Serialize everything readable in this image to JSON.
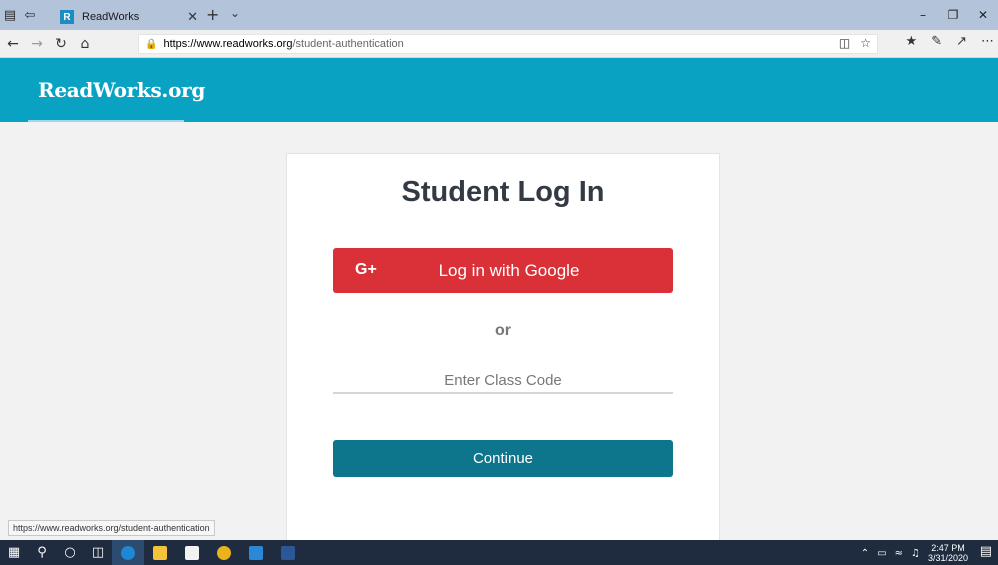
{
  "browser": {
    "tab_title": "ReadWorks",
    "tab_favicon_letter": "R",
    "url_host": "https://www.readworks.org",
    "url_path": "/student-authentication",
    "status_url": "https://www.readworks.org/student-authentication"
  },
  "site": {
    "logo": "ReadWorks.org",
    "header_color": "#0aa2c2"
  },
  "login": {
    "title": "Student Log In",
    "google_icon": "G+",
    "google_label": "Log in with Google",
    "google_color": "#da3038",
    "or_text": "or",
    "class_code_placeholder": "Enter Class Code",
    "continue_label": "Continue",
    "continue_color": "#0d758c"
  },
  "taskbar": {
    "time": "2:47 PM",
    "date": "3/31/2020"
  }
}
